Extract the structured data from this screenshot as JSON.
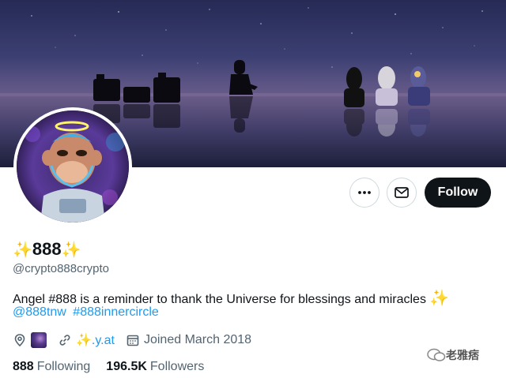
{
  "banner": {
    "description_icon": "desert-night-banner"
  },
  "profile": {
    "display_name": "888",
    "name_emoji": "✨",
    "handle": "@crypto888crypto",
    "bio": "Angel #888 is a reminder to thank the Universe for blessings and miracles",
    "bio_emoji": "✨",
    "tags": [
      "@888tnw",
      "#888innercircle"
    ],
    "location_icon": "galaxy-emoji",
    "website": "✨.y.at",
    "joined": "Joined March 2018",
    "following_count": "888",
    "following_label": "Following",
    "followers_count": "196.5K",
    "followers_label": "Followers"
  },
  "actions": {
    "more_icon": "more-icon",
    "message_icon": "mail-icon",
    "follow_label": "Follow"
  },
  "watermark": {
    "text": "老雅痞"
  },
  "colors": {
    "accent": "#1d9bf0",
    "text": "#0f1419",
    "muted": "#536471"
  }
}
